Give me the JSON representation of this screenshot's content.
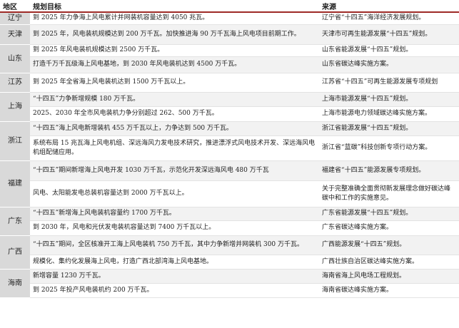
{
  "headers": {
    "region": "地区",
    "goal": "规划目标",
    "source": "来源"
  },
  "colors": {
    "header_rule": "#9e2a26",
    "region_bg": "#d9d9d9",
    "row_shade": "#f2f2f2"
  },
  "rows": [
    {
      "region": "辽宁",
      "span": 1,
      "goal": "到 2025 年力争海上风电累计并网装机容量达到 4050 兆瓦。",
      "source": "辽宁省“十四五”海洋经济发展规划。"
    },
    {
      "region": "天津",
      "span": 1,
      "goal": "到 2025 年，风电装机规模达到 200 万千瓦。加快推进海 90 万千瓦海上风电项目前期工作。",
      "source": "天津市可再生能源发展“十四五”规划。"
    },
    {
      "region": "山东",
      "span": 2,
      "goal": "到 2025 年风电装机规模达到 2500 万千瓦。",
      "source": "山东省能源发展“十四五”规划。"
    },
    {
      "region": "",
      "span": 0,
      "goal": "打造千万千瓦级海上风电基地，到 2030 年风电装机达到 4500 万千瓦。",
      "source": "山东省碳达峰实施方案。"
    },
    {
      "region": "江苏",
      "span": 1,
      "goal": "到 2025 年全省海上风电装机达到 1500 万千瓦以上。",
      "source": "江苏省“十四五”可再生能源发展专项规划"
    },
    {
      "region": "上海",
      "span": 2,
      "goal": "“十四五”力争新增规模 180 万千瓦。",
      "source": "上海市能源发展“十四五”规划。"
    },
    {
      "region": "",
      "span": 0,
      "goal": "2025、2030 年全市风电装机力争分别超过 262、500 万千瓦。",
      "source": "上海市能源电力领域碳达峰实施方案。"
    },
    {
      "region": "浙江",
      "span": 2,
      "goal": "“十四五”海上风电新增装机 455 万千瓦以上，力争达到 500 万千瓦。",
      "source": "浙江省能源发展“十四五”规划。"
    },
    {
      "region": "",
      "span": 0,
      "goal": "系统布局 15 兆瓦海上风电机组、深远海风力发电技术研究，推进漂浮式风电技术开发、深远海风电机组配储应用。",
      "source": "浙江省“蓝碳”科技创新专项行动方案。"
    },
    {
      "region": "福建",
      "span": 2,
      "goal": "“十四五”期间新增海上风电开发 1030 万千瓦，示范化开发深远海风电 480 万千瓦",
      "source": "福建省“十四五”能源发展专项规划。"
    },
    {
      "region": "",
      "span": 0,
      "goal": "风电、太阳能发电总装机容量达到 2000 万千瓦以上。",
      "source": "关于完整准确全面贯彻新发展理念做好碳达峰碳中和工作的实施意见。"
    },
    {
      "region": "广东",
      "span": 2,
      "goal": "“十四五”新增海上风电装机容量约 1700 万千瓦。",
      "source": "广东省能源发展“十四五”规划。"
    },
    {
      "region": "",
      "span": 0,
      "goal": "到 2030 年，风电和光伏发电装机容量达到 7400 万千瓦以上。",
      "source": "广东省碳达峰实施方案。"
    },
    {
      "region": "广西",
      "span": 2,
      "goal": "“十四五”期间，全区核准开工海上风电装机 750 万千瓦，其中力争新增并网装机 300 万千瓦。",
      "source": "广西能源发展“十四五”规划。"
    },
    {
      "region": "",
      "span": 0,
      "goal": "规模化、集约化发展海上风电，打造广西北部湾海上风电基地。",
      "source": "广西壮族自治区碳达峰实施方案。"
    },
    {
      "region": "海南",
      "span": 2,
      "goal": "新增容量 1230 万千瓦。",
      "source": "海南省海上风电场工程规划。"
    },
    {
      "region": "",
      "span": 0,
      "goal": "到 2025 年投产风电装机约 200 万千瓦。",
      "source": "海南省碳达峰实施方案。"
    }
  ]
}
